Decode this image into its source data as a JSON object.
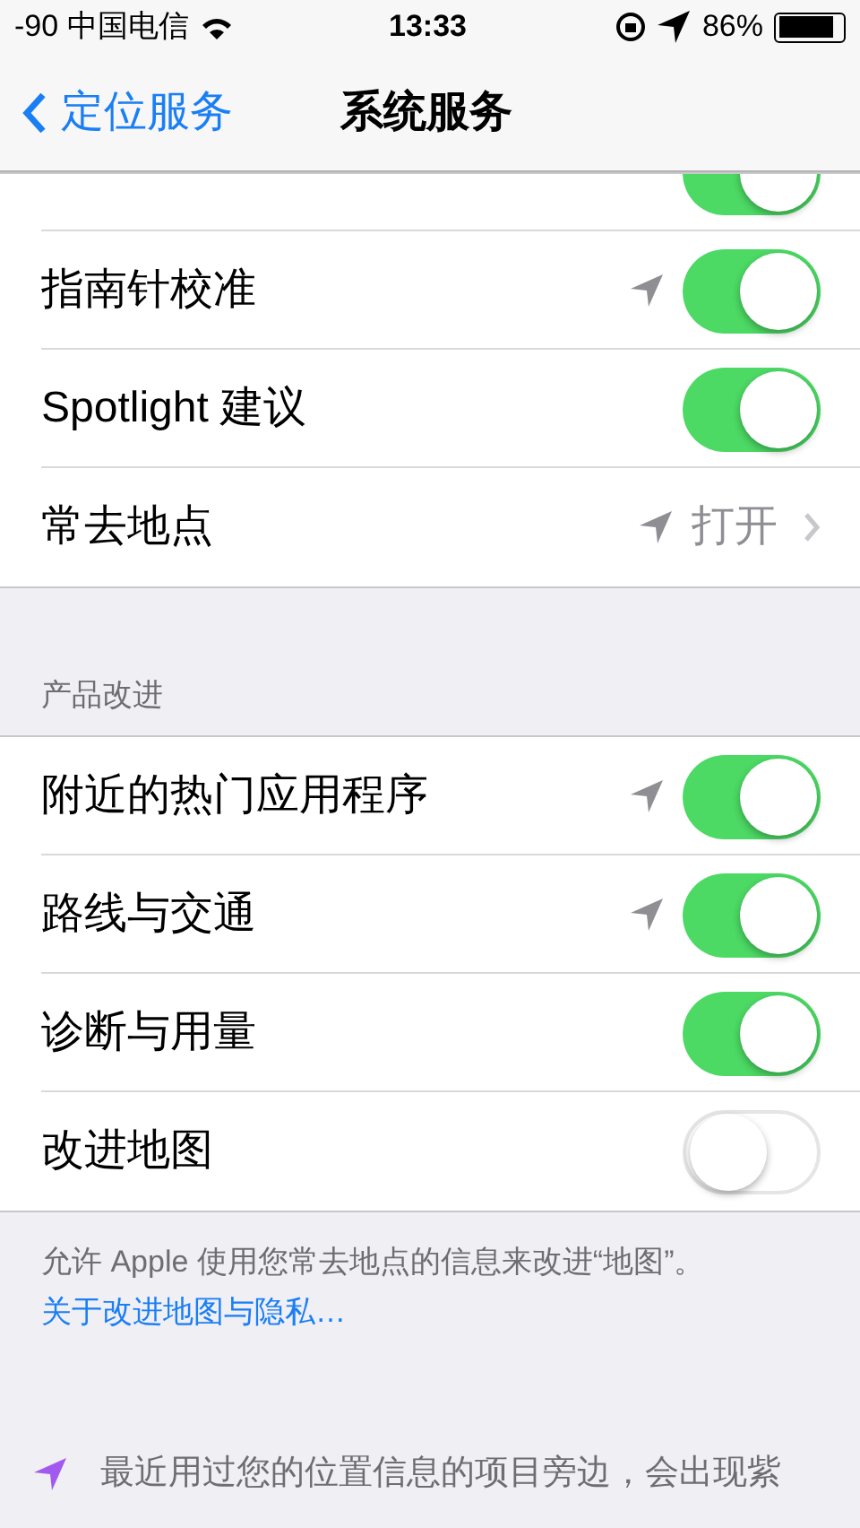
{
  "status_bar": {
    "signal": "-90",
    "carrier": "中国电信",
    "time": "13:33",
    "battery": "86%"
  },
  "nav": {
    "back": "定位服务",
    "title": "系统服务"
  },
  "sections": [
    {
      "rows": [
        {
          "kind": "partial",
          "on": true
        },
        {
          "kind": "toggle",
          "label": "指南针校准",
          "location_arrow": true,
          "on": true
        },
        {
          "kind": "toggle",
          "label": "Spotlight 建议",
          "location_arrow": false,
          "on": true
        },
        {
          "kind": "link",
          "label": "常去地点",
          "location_arrow": true,
          "value": "打开"
        }
      ]
    },
    {
      "header": "产品改进",
      "rows": [
        {
          "kind": "toggle",
          "label": "附近的热门应用程序",
          "location_arrow": true,
          "on": true
        },
        {
          "kind": "toggle",
          "label": "路线与交通",
          "location_arrow": true,
          "on": true
        },
        {
          "kind": "toggle",
          "label": "诊断与用量",
          "location_arrow": false,
          "on": true
        },
        {
          "kind": "toggle",
          "label": "改进地图",
          "location_arrow": false,
          "on": false
        }
      ],
      "footer": "允许 Apple 使用您常去地点的信息来改进“地图”。",
      "footer_link": "关于改进地图与隐私…"
    }
  ],
  "note": "最近用过您的位置信息的项目旁边，会出现紫"
}
